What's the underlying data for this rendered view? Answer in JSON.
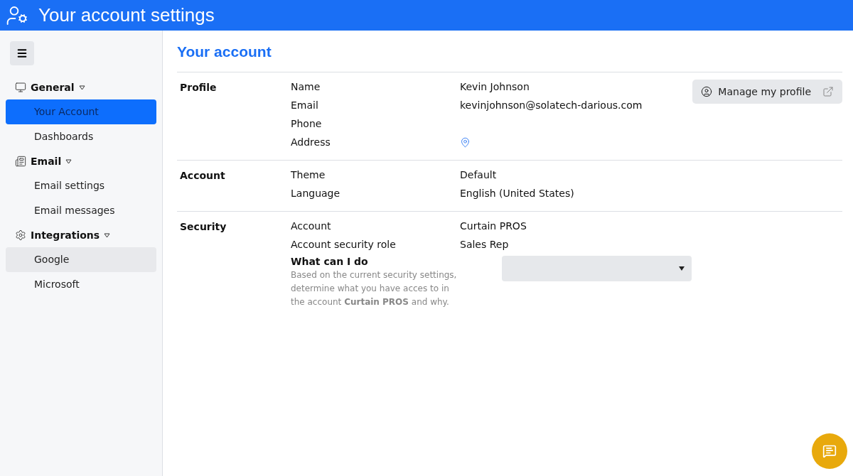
{
  "header": {
    "title": "Your account settings"
  },
  "sidebar": {
    "groups": [
      {
        "title": "General",
        "kind": "monitor",
        "expanded": true,
        "items": [
          {
            "label": "Your Account",
            "selected": true,
            "hovered": false
          },
          {
            "label": "Dashboards",
            "selected": false,
            "hovered": false
          }
        ]
      },
      {
        "title": "Email",
        "kind": "newspaper",
        "expanded": true,
        "items": [
          {
            "label": "Email settings",
            "selected": false,
            "hovered": false
          },
          {
            "label": "Email messages",
            "selected": false,
            "hovered": false
          }
        ]
      },
      {
        "title": "Integrations",
        "kind": "gear",
        "expanded": true,
        "items": [
          {
            "label": "Google",
            "selected": false,
            "hovered": true
          },
          {
            "label": "Microsoft",
            "selected": false,
            "hovered": false
          }
        ]
      }
    ]
  },
  "page_title": "Your account",
  "sections": [
    {
      "title": "Profile",
      "action": {
        "label": "Manage my profile"
      },
      "rows": [
        {
          "label": "Name",
          "kind": "text",
          "value": "Kevin Johnson"
        },
        {
          "label": "Email",
          "kind": "text",
          "value": "kevinjohnson@solatech-darious.com"
        },
        {
          "label": "Phone",
          "kind": "text"
        },
        {
          "label": "Address",
          "kind": "location"
        }
      ]
    },
    {
      "title": "Account",
      "rows": [
        {
          "label": "Theme",
          "kind": "text",
          "value": "Default"
        },
        {
          "label": "Language",
          "kind": "text",
          "value": "English (United States)"
        }
      ]
    },
    {
      "title": "Security",
      "rows": [
        {
          "label": "Account",
          "kind": "text",
          "value": "Curtain PROS"
        },
        {
          "label": "Account security role",
          "kind": "text",
          "value": "Sales Rep"
        }
      ],
      "question": {
        "title": "What can I do",
        "description": "Based on the current security settings, determine what you have acces to in the account **Curtain PROS** and why."
      }
    }
  ]
}
